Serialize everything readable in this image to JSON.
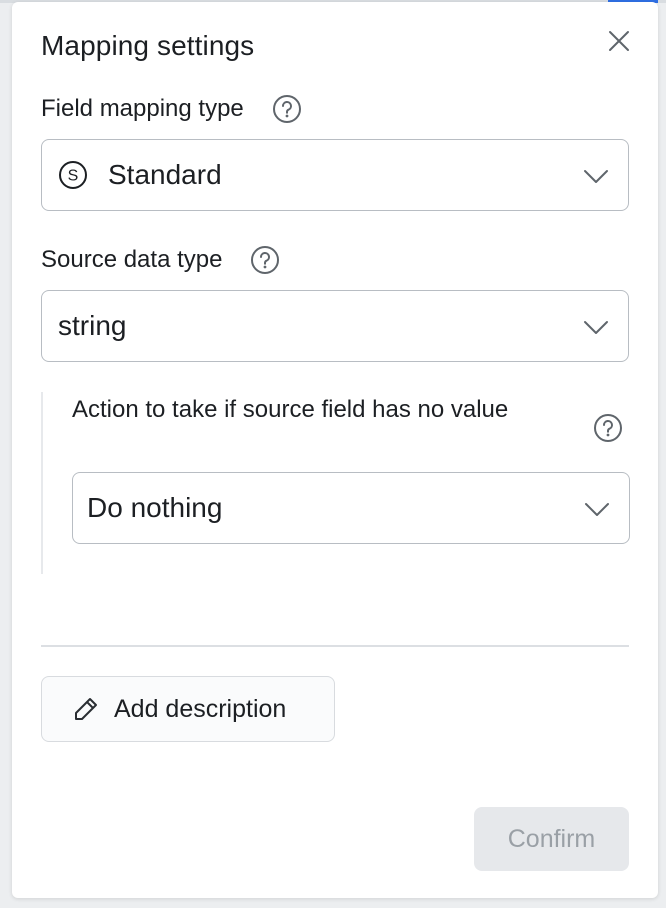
{
  "dialog": {
    "title": "Mapping settings"
  },
  "field_mapping_type": {
    "label": "Field mapping type",
    "value": "Standard",
    "value_icon": "circle-s-icon"
  },
  "source_data_type": {
    "label": "Source data type",
    "value": "string"
  },
  "no_value_action": {
    "label": "Action to take if source field has no value",
    "value": "Do nothing"
  },
  "actions": {
    "add_description_label": "Add description",
    "confirm_label": "Confirm"
  },
  "colors": {
    "accent": "#2f6fe4",
    "border": "#b8bdc3",
    "disabled_bg": "#e6e8eb",
    "disabled_text": "#9aa0a6"
  }
}
